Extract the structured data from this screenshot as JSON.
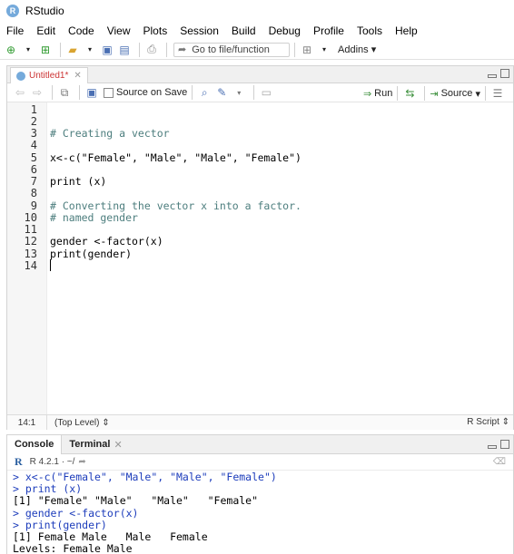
{
  "app": {
    "title": "RStudio",
    "logo_letter": "R"
  },
  "menu": [
    "File",
    "Edit",
    "Code",
    "View",
    "Plots",
    "Session",
    "Build",
    "Debug",
    "Profile",
    "Tools",
    "Help"
  ],
  "toolbar": {
    "goto_placeholder": "Go to file/function",
    "addins_label": "Addins"
  },
  "editor": {
    "tab_title": "Untitled1*",
    "source_on_save_label": "Source on Save",
    "run_label": "Run",
    "source_label": "Source",
    "line_numbers": [
      "1",
      "2",
      "3",
      "4",
      "5",
      "6",
      "7",
      "8",
      "9",
      "10",
      "11",
      "12",
      "13",
      "14"
    ],
    "lines": [
      "",
      "",
      "# Creating a vector",
      "",
      "x<-c(\"Female\", \"Male\", \"Male\", \"Female\")",
      "",
      "print (x)",
      "",
      "# Converting the vector x into a factor.",
      "# named gender",
      "",
      "gender <-factor(x)",
      "print(gender)",
      ""
    ],
    "status": {
      "position": "14:1",
      "scope": "(Top Level) ⇕",
      "file_type": "R Script ⇕"
    }
  },
  "console": {
    "tabs": [
      "Console",
      "Terminal"
    ],
    "r_version": "R 4.2.1 · ~/",
    "lines": [
      {
        "kind": "input",
        "text": "> x<-c(\"Female\", \"Male\", \"Male\", \"Female\")"
      },
      {
        "kind": "input",
        "text": "> print (x)"
      },
      {
        "kind": "output",
        "text": "[1] \"Female\" \"Male\"   \"Male\"   \"Female\""
      },
      {
        "kind": "input",
        "text": "> gender <-factor(x)"
      },
      {
        "kind": "input",
        "text": "> print(gender)"
      },
      {
        "kind": "output",
        "text": "[1] Female Male   Male   Female"
      },
      {
        "kind": "output",
        "text": "Levels: Female Male"
      }
    ]
  }
}
